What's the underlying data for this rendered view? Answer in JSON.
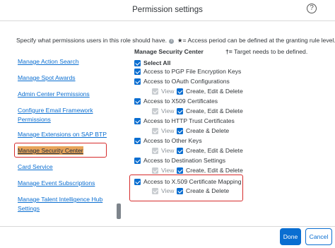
{
  "dialog": {
    "title": "Permission settings",
    "help_icon": "help-circle-icon",
    "intro_text": "Specify what permissions users in this role should have.",
    "intro_note": "★= Access period can be defined at the granting rule level."
  },
  "left_nav": {
    "items": [
      {
        "label": "Manage Action Search"
      },
      {
        "label": "Manage Spot Awards"
      },
      {
        "label": "Admin Center Permissions"
      },
      {
        "label": "Configure Email Framework"
      },
      {
        "label": "Permissions"
      },
      {
        "label": "Manage Extensions on SAP BTP"
      },
      {
        "label": "Manage Security Center",
        "selected": true
      },
      {
        "label": "Card Service"
      },
      {
        "label": "Manage Event Subscriptions"
      },
      {
        "label": "Manage Talent Intelligence Hub"
      },
      {
        "label": "Settings"
      }
    ],
    "selected_color": "#e8a45a",
    "highlight_color": "#d62b2b"
  },
  "right_panel": {
    "section_title": "Manage Security Center",
    "target_note_symbol": "†=",
    "target_note_text": "Target needs to be defined.",
    "select_all": "Select All",
    "permissions": [
      {
        "label": "Access to PGP File Encryption Keys",
        "checked": true
      },
      {
        "label": "Access to OAuth Configurations",
        "checked": true,
        "sub": {
          "view": "View",
          "edit": "Create, Edit & Delete"
        }
      },
      {
        "label": "Access to X509 Certificates",
        "checked": true,
        "sub": {
          "view": "View",
          "edit": "Create, Edit & Delete"
        }
      },
      {
        "label": "Access to HTTP Trust Certificates",
        "checked": true,
        "sub": {
          "view": "View",
          "edit": "Create & Delete"
        }
      },
      {
        "label": "Access to Other Keys",
        "checked": true,
        "sub": {
          "view": "View",
          "edit": "Create, Edit & Delete"
        }
      },
      {
        "label": "Access to Destination Settings",
        "checked": true,
        "sub": {
          "view": "View",
          "edit": "Create, Edit & Delete"
        }
      },
      {
        "label": "Access to X.509 Certificate Mapping",
        "checked": true,
        "sub": {
          "view": "View",
          "edit": "Create & Delete"
        }
      }
    ]
  },
  "footer": {
    "done_label": "Done",
    "cancel_label": "Cancel"
  },
  "colors": {
    "accent": "#0a6ed1",
    "checkbox_disabled": "#c9cdd1"
  }
}
